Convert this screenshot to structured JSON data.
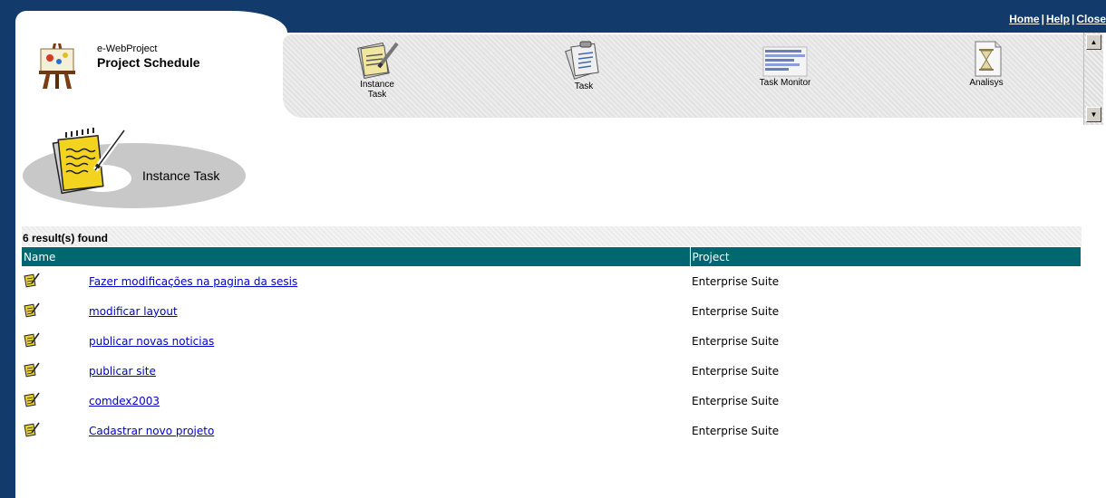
{
  "top_links": {
    "home": "Home",
    "help": "Help",
    "close": "Close",
    "separator": "|"
  },
  "brand": {
    "subtitle": "e-WebProject",
    "title": "Project Schedule"
  },
  "toolbar": [
    {
      "label_line1": "Instance",
      "label_line2": "Task",
      "icon": "notepad-pencil-icon"
    },
    {
      "label_line1": "Task",
      "label_line2": "",
      "icon": "clipboard-icon"
    },
    {
      "label_line1": "Task Monitor",
      "label_line2": "",
      "icon": "bar-chart-icon"
    },
    {
      "label_line1": "Analisys",
      "label_line2": "",
      "icon": "hourglass-icon"
    }
  ],
  "page_heading": "Instance Task",
  "results": {
    "count_text": "6 result(s) found",
    "columns": [
      "Name",
      "Project"
    ],
    "rows": [
      {
        "name": "Fazer modificações na pagina da sesis",
        "project": "Enterprise Suite"
      },
      {
        "name": "modificar layout",
        "project": "Enterprise Suite"
      },
      {
        "name": "publicar novas noticias",
        "project": "Enterprise Suite"
      },
      {
        "name": "publicar site",
        "project": "Enterprise Suite"
      },
      {
        "name": "comdex2003",
        "project": "Enterprise Suite"
      },
      {
        "name": "Cadastrar novo projeto",
        "project": "Enterprise Suite"
      }
    ]
  },
  "colors": {
    "frame": "#123a6b",
    "table_header": "#006670",
    "link": "#0000cc"
  }
}
